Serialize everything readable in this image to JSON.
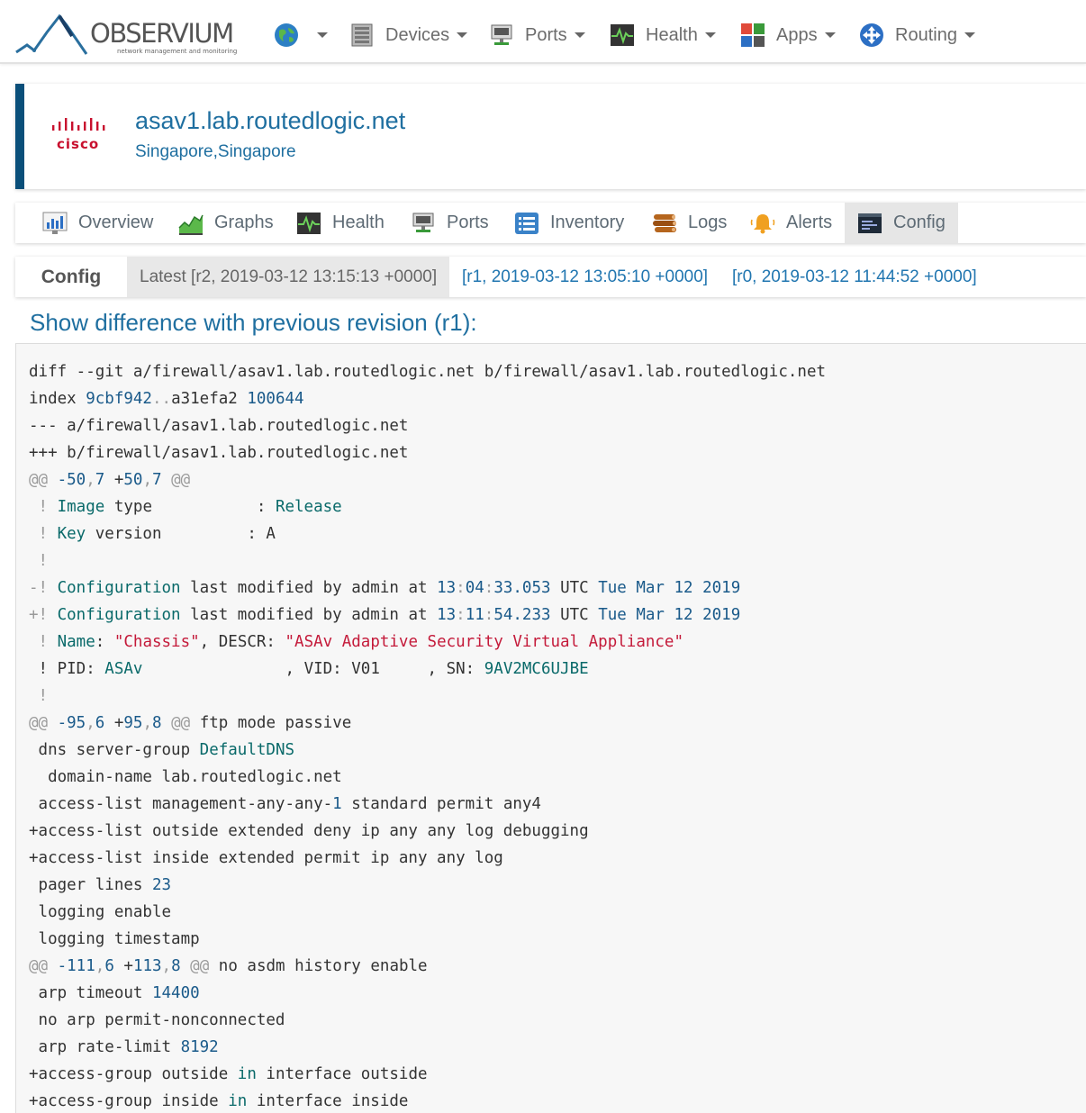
{
  "brand": {
    "name": "OBSERVIUM",
    "tagline": "network management and monitoring"
  },
  "navbar": {
    "items": [
      {
        "label": "",
        "icon": "globe-icon"
      },
      {
        "label": "Devices",
        "icon": "server-icon"
      },
      {
        "label": "Ports",
        "icon": "network-port-icon"
      },
      {
        "label": "Health",
        "icon": "heartbeat-icon"
      },
      {
        "label": "Apps",
        "icon": "apps-grid-icon"
      },
      {
        "label": "Routing",
        "icon": "routing-icon"
      }
    ]
  },
  "device": {
    "vendor_logo": "cisco",
    "hostname": "asav1.lab.routedlogic.net",
    "location": "Singapore,Singapore"
  },
  "tabs": [
    {
      "label": "Overview",
      "icon": "overview-chart-icon"
    },
    {
      "label": "Graphs",
      "icon": "graphs-icon"
    },
    {
      "label": "Health",
      "icon": "heartbeat-icon"
    },
    {
      "label": "Ports",
      "icon": "network-port-icon"
    },
    {
      "label": "Inventory",
      "icon": "inventory-list-icon"
    },
    {
      "label": "Logs",
      "icon": "logs-icon"
    },
    {
      "label": "Alerts",
      "icon": "bell-icon"
    },
    {
      "label": "Config",
      "icon": "config-terminal-icon",
      "active": true
    }
  ],
  "config": {
    "label": "Config",
    "current": "Latest [r2, 2019-03-12 13:15:13 +0000]",
    "revisions": [
      "[r1, 2019-03-12 13:05:10 +0000]",
      "[r0, 2019-03-12 11:44:52 +0000]"
    ],
    "diff_title": "Show difference with previous revision (r1):"
  },
  "diff_lines": [
    [
      [
        "diff --git a/firewall/asav1.lab.routedlogic.net b/firewall/asav1.lab.routedlogic.net",
        ""
      ]
    ],
    [
      [
        "index ",
        ""
      ],
      [
        "9cbf942",
        "num"
      ],
      [
        "..",
        "p"
      ],
      [
        "a31efa2 ",
        ""
      ],
      [
        "100644",
        "num"
      ]
    ],
    [
      [
        "--- a/firewall/asav1.lab.routedlogic.net",
        ""
      ]
    ],
    [
      [
        "+++ b/firewall/asav1.lab.routedlogic.net",
        ""
      ]
    ],
    [
      [
        "@@ ",
        "p"
      ],
      [
        "-50",
        "num"
      ],
      [
        ",",
        "p"
      ],
      [
        "7",
        "num"
      ],
      [
        " +",
        ""
      ],
      [
        "50",
        "num"
      ],
      [
        ",",
        "p"
      ],
      [
        "7",
        "num"
      ],
      [
        " @@",
        "p"
      ]
    ],
    [
      [
        " ! ",
        "p"
      ],
      [
        "Image",
        "kw"
      ],
      [
        " type           : ",
        ""
      ],
      [
        "Release",
        "kw"
      ]
    ],
    [
      [
        " ! ",
        "p"
      ],
      [
        "Key",
        "kw"
      ],
      [
        " version         : A",
        ""
      ]
    ],
    [
      [
        " !",
        "p"
      ]
    ],
    [
      [
        "-! ",
        "p"
      ],
      [
        "Configuration",
        "kw"
      ],
      [
        " last modified by admin at ",
        ""
      ],
      [
        "13",
        "num"
      ],
      [
        ":",
        "p"
      ],
      [
        "04",
        "num"
      ],
      [
        ":",
        "p"
      ],
      [
        "33.053",
        "num"
      ],
      [
        " UTC ",
        ""
      ],
      [
        "Tue Mar 12 2019",
        "num"
      ]
    ],
    [
      [
        "+! ",
        "p"
      ],
      [
        "Configuration",
        "kw"
      ],
      [
        " last modified by admin at ",
        ""
      ],
      [
        "13",
        "num"
      ],
      [
        ":",
        "p"
      ],
      [
        "11",
        "num"
      ],
      [
        ":",
        "p"
      ],
      [
        "54.233",
        "num"
      ],
      [
        " UTC ",
        ""
      ],
      [
        "Tue Mar 12 2019",
        "num"
      ]
    ],
    [
      [
        " ! ",
        "p"
      ],
      [
        "Name",
        "kw"
      ],
      [
        ": ",
        ""
      ],
      [
        "\"Chassis\"",
        "str"
      ],
      [
        ", DESCR: ",
        ""
      ],
      [
        "\"ASAv Adaptive Security Virtual Appliance\"",
        "str"
      ]
    ],
    [
      [
        " ! PID: ",
        ""
      ],
      [
        "ASAv",
        "kw"
      ],
      [
        "               , VID: V01     , SN: ",
        ""
      ],
      [
        "9AV2MC6UJBE",
        "kw"
      ]
    ],
    [
      [
        " !",
        "p"
      ]
    ],
    [
      [
        "@@ ",
        "p"
      ],
      [
        "-95",
        "num"
      ],
      [
        ",",
        "p"
      ],
      [
        "6",
        "num"
      ],
      [
        " +",
        ""
      ],
      [
        "95",
        "num"
      ],
      [
        ",",
        "p"
      ],
      [
        "8",
        "num"
      ],
      [
        " @@ ",
        "p"
      ],
      [
        "ftp mode passive",
        ""
      ]
    ],
    [
      [
        " dns server-group ",
        ""
      ],
      [
        "DefaultDNS",
        "kw"
      ]
    ],
    [
      [
        "  domain-name lab.routedlogic.net",
        ""
      ]
    ],
    [
      [
        " access-list management-any-any-",
        ""
      ],
      [
        "1",
        "num"
      ],
      [
        " standard permit any4",
        ""
      ]
    ],
    [
      [
        "+access-list outside extended deny ip any any log debugging",
        ""
      ]
    ],
    [
      [
        "+access-list inside extended permit ip any any log",
        ""
      ]
    ],
    [
      [
        " pager lines ",
        ""
      ],
      [
        "23",
        "num"
      ]
    ],
    [
      [
        " logging enable",
        ""
      ]
    ],
    [
      [
        " logging timestamp",
        ""
      ]
    ],
    [
      [
        "@@ ",
        "p"
      ],
      [
        "-111",
        "num"
      ],
      [
        ",",
        "p"
      ],
      [
        "6",
        "num"
      ],
      [
        " +",
        ""
      ],
      [
        "113",
        "num"
      ],
      [
        ",",
        "p"
      ],
      [
        "8",
        "num"
      ],
      [
        " @@ ",
        "p"
      ],
      [
        "no asdm history enable",
        ""
      ]
    ],
    [
      [
        " arp timeout ",
        ""
      ],
      [
        "14400",
        "num"
      ]
    ],
    [
      [
        " no arp permit-nonconnected",
        ""
      ]
    ],
    [
      [
        " arp rate-limit ",
        ""
      ],
      [
        "8192",
        "num"
      ]
    ],
    [
      [
        "+access-group outside ",
        ""
      ],
      [
        "in",
        "kw"
      ],
      [
        " interface outside",
        ""
      ]
    ],
    [
      [
        "+access-group inside ",
        ""
      ],
      [
        "in",
        "kw"
      ],
      [
        " interface inside",
        ""
      ]
    ]
  ]
}
